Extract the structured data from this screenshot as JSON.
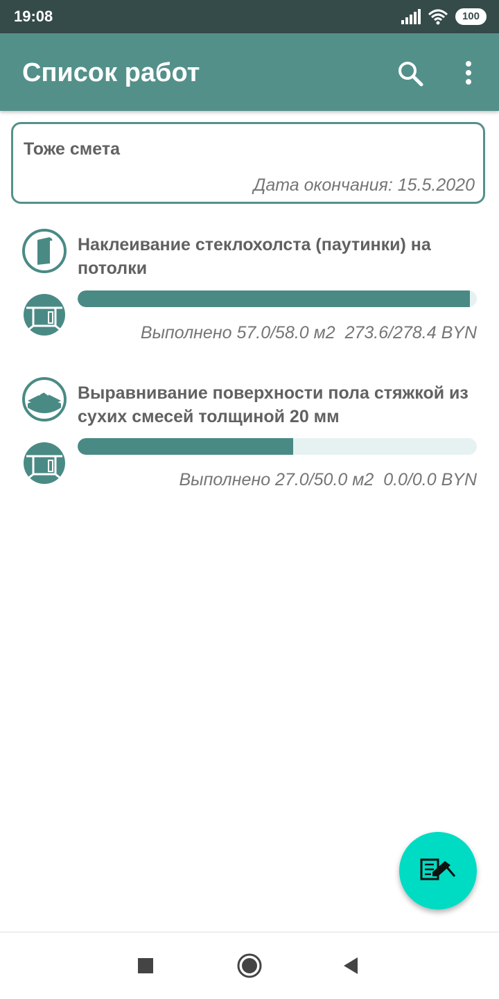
{
  "status_bar": {
    "time": "19:08",
    "battery": "100",
    "icons": [
      "signal-icon",
      "wifi-icon",
      "battery-icon"
    ]
  },
  "app_bar": {
    "title": "Список работ",
    "actions": [
      "search-icon",
      "more-vert-icon"
    ]
  },
  "estimate": {
    "title": "Тоже смета",
    "end_date": "Дата окончания: 15.5.2020"
  },
  "works": [
    {
      "title": "Наклеивание стеклохолста (паутинки) на потолки",
      "progress": 0.983,
      "summary": "Выполнено 57.0/58.0 м2  273.6/278.4 BYN",
      "icons": [
        "wallpaper-roll-icon",
        "room-icon"
      ]
    },
    {
      "title": "Выравнивание поверхности пола стяжкой из сухих смесей толщиной 20 мм",
      "progress": 0.54,
      "summary": "Выполнено 27.0/50.0 м2  0.0/0.0 BYN",
      "icons": [
        "floor-screed-icon",
        "room-icon"
      ]
    }
  ],
  "fab": {
    "icon": "estimate-edit-icon"
  },
  "nav_bar": {
    "buttons": [
      "recents-square-icon",
      "home-circle-icon",
      "back-triangle-icon"
    ]
  },
  "colors": {
    "status_bar": "#354b4a",
    "app_bar": "#54908a",
    "accent": "#4a8a85",
    "progress_track": "#e5f2f1",
    "fab": "#00dcc4"
  }
}
